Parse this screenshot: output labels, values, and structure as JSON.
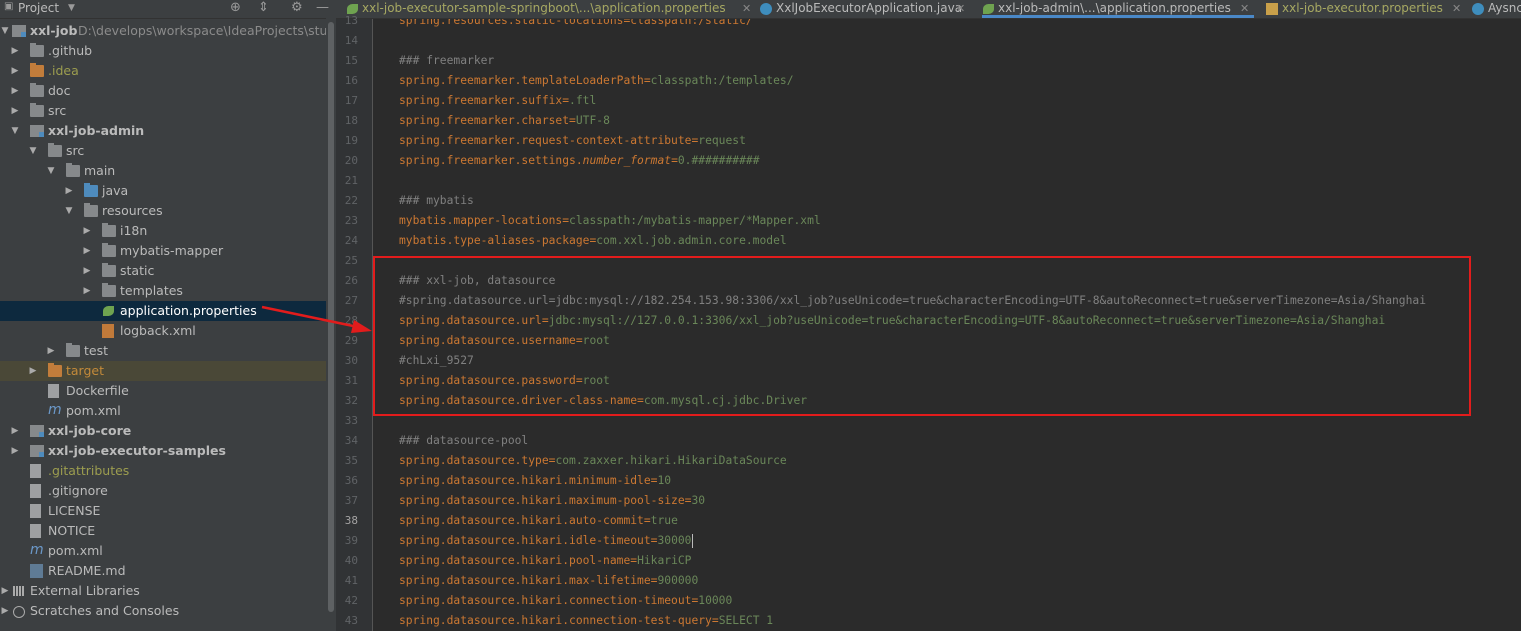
{
  "project_panel": {
    "title": "Project",
    "tree": [
      {
        "label": "xxl-job",
        "path": "D:\\develops\\workspace\\IdeaProjects\\study-"
      },
      {
        "label": ".github"
      },
      {
        "label": ".idea"
      },
      {
        "label": "doc"
      },
      {
        "label": "src"
      },
      {
        "label": "xxl-job-admin"
      },
      {
        "label": "src"
      },
      {
        "label": "main"
      },
      {
        "label": "java"
      },
      {
        "label": "resources"
      },
      {
        "label": "i18n"
      },
      {
        "label": "mybatis-mapper"
      },
      {
        "label": "static"
      },
      {
        "label": "templates"
      },
      {
        "label": "application.properties"
      },
      {
        "label": "logback.xml"
      },
      {
        "label": "test"
      },
      {
        "label": "target"
      },
      {
        "label": "Dockerfile"
      },
      {
        "label": "pom.xml"
      },
      {
        "label": "xxl-job-core"
      },
      {
        "label": "xxl-job-executor-samples"
      },
      {
        "label": ".gitattributes"
      },
      {
        "label": ".gitignore"
      },
      {
        "label": "LICENSE"
      },
      {
        "label": "NOTICE"
      },
      {
        "label": "pom.xml"
      },
      {
        "label": "README.md"
      },
      {
        "label": "External Libraries"
      },
      {
        "label": "Scratches and Consoles"
      }
    ]
  },
  "tabs": [
    {
      "label": "xxl-job-executor-sample-springboot\\...\\application.properties"
    },
    {
      "label": "XxlJobExecutorApplication.java"
    },
    {
      "label": "xxl-job-admin\\...\\application.properties"
    },
    {
      "label": "xxl-job-executor.properties"
    },
    {
      "label": "Aysnc"
    }
  ],
  "editor": {
    "current_line": "38",
    "lines": [
      {
        "n": "13",
        "p": [
          {
            "t": "spring.resources.static-locations=classpath:/static/",
            "c": "k"
          }
        ]
      },
      {
        "n": "14",
        "p": []
      },
      {
        "n": "15",
        "p": [
          {
            "t": "### freemarker",
            "c": "cm"
          }
        ]
      },
      {
        "n": "16",
        "p": [
          {
            "t": "spring.freemarker.templateLoaderPath",
            "c": "k"
          },
          {
            "t": "=",
            "c": "eq"
          },
          {
            "t": "classpath:/templates/",
            "c": "v"
          }
        ]
      },
      {
        "n": "17",
        "p": [
          {
            "t": "spring.freemarker.suffix",
            "c": "k"
          },
          {
            "t": "=",
            "c": "eq"
          },
          {
            "t": ".ftl",
            "c": "v"
          }
        ]
      },
      {
        "n": "18",
        "p": [
          {
            "t": "spring.freemarker.charset",
            "c": "k"
          },
          {
            "t": "=",
            "c": "eq"
          },
          {
            "t": "UTF-8",
            "c": "v"
          }
        ]
      },
      {
        "n": "19",
        "p": [
          {
            "t": "spring.freemarker.request-context-attribute",
            "c": "k"
          },
          {
            "t": "=",
            "c": "eq"
          },
          {
            "t": "request",
            "c": "v"
          }
        ]
      },
      {
        "n": "20",
        "p": [
          {
            "t": "spring.freemarker.settings.",
            "c": "k"
          },
          {
            "t": "number_format",
            "c": "k it"
          },
          {
            "t": "=",
            "c": "eq"
          },
          {
            "t": "0.##########",
            "c": "v"
          }
        ]
      },
      {
        "n": "21",
        "p": []
      },
      {
        "n": "22",
        "p": [
          {
            "t": "### mybatis",
            "c": "cm"
          }
        ]
      },
      {
        "n": "23",
        "p": [
          {
            "t": "mybatis.mapper-locations",
            "c": "k"
          },
          {
            "t": "=",
            "c": "eq"
          },
          {
            "t": "classpath:/mybatis-mapper/*Mapper.xml",
            "c": "v"
          }
        ]
      },
      {
        "n": "24",
        "p": [
          {
            "t": "mybatis.type-aliases-package",
            "c": "k"
          },
          {
            "t": "=",
            "c": "eq"
          },
          {
            "t": "com.xxl.job.admin.core.model",
            "c": "v"
          }
        ]
      },
      {
        "n": "25",
        "p": []
      },
      {
        "n": "26",
        "p": [
          {
            "t": "### xxl-job, datasource",
            "c": "cm"
          }
        ]
      },
      {
        "n": "27",
        "p": [
          {
            "t": "#spring.datasource.url=jdbc:mysql://182.254.153.98:3306/xxl_job?useUnicode=true&characterEncoding=UTF-8&autoReconnect=true&serverTimezone=Asia/Shanghai",
            "c": "cm"
          }
        ]
      },
      {
        "n": "28",
        "p": [
          {
            "t": "spring.datasource.url",
            "c": "k"
          },
          {
            "t": "=",
            "c": "eq"
          },
          {
            "t": "jdbc:mysql://127.0.0.1:3306/xxl_job?useUnicode=true&characterEncoding=UTF-8&autoReconnect=true&serverTimezone=Asia/Shanghai",
            "c": "v"
          }
        ]
      },
      {
        "n": "29",
        "p": [
          {
            "t": "spring.datasource.username",
            "c": "k"
          },
          {
            "t": "=",
            "c": "eq"
          },
          {
            "t": "root",
            "c": "v"
          }
        ]
      },
      {
        "n": "30",
        "p": [
          {
            "t": "#chLxi_9527",
            "c": "cm"
          }
        ]
      },
      {
        "n": "31",
        "p": [
          {
            "t": "spring.datasource.password",
            "c": "k"
          },
          {
            "t": "=",
            "c": "eq"
          },
          {
            "t": "root",
            "c": "v"
          }
        ]
      },
      {
        "n": "32",
        "p": [
          {
            "t": "spring.datasource.driver-class-name",
            "c": "k"
          },
          {
            "t": "=",
            "c": "eq"
          },
          {
            "t": "com.mysql.cj.jdbc.Driver",
            "c": "v"
          }
        ]
      },
      {
        "n": "33",
        "p": []
      },
      {
        "n": "34",
        "p": [
          {
            "t": "### datasource-pool",
            "c": "cm"
          }
        ]
      },
      {
        "n": "35",
        "p": [
          {
            "t": "spring.datasource.type",
            "c": "k"
          },
          {
            "t": "=",
            "c": "eq"
          },
          {
            "t": "com.zaxxer.hikari.HikariDataSource",
            "c": "v"
          }
        ]
      },
      {
        "n": "36",
        "p": [
          {
            "t": "spring.datasource.hikari.minimum-idle",
            "c": "k"
          },
          {
            "t": "=",
            "c": "eq"
          },
          {
            "t": "10",
            "c": "v"
          }
        ]
      },
      {
        "n": "37",
        "p": [
          {
            "t": "spring.datasource.hikari.maximum-pool-size",
            "c": "k"
          },
          {
            "t": "=",
            "c": "eq"
          },
          {
            "t": "30",
            "c": "v"
          }
        ]
      },
      {
        "n": "38",
        "p": [
          {
            "t": "spring.datasource.hikari.auto-commit",
            "c": "k"
          },
          {
            "t": "=",
            "c": "eq"
          },
          {
            "t": "true",
            "c": "v"
          }
        ]
      },
      {
        "n": "39",
        "p": [
          {
            "t": "spring.datasource.hikari.idle-timeout",
            "c": "k"
          },
          {
            "t": "=",
            "c": "eq"
          },
          {
            "t": "30000",
            "c": "v"
          }
        ]
      },
      {
        "n": "40",
        "p": [
          {
            "t": "spring.datasource.hikari.pool-name",
            "c": "k"
          },
          {
            "t": "=",
            "c": "eq"
          },
          {
            "t": "HikariCP",
            "c": "v"
          }
        ]
      },
      {
        "n": "41",
        "p": [
          {
            "t": "spring.datasource.hikari.max-lifetime",
            "c": "k"
          },
          {
            "t": "=",
            "c": "eq"
          },
          {
            "t": "900000",
            "c": "v"
          }
        ]
      },
      {
        "n": "42",
        "p": [
          {
            "t": "spring.datasource.hikari.connection-timeout",
            "c": "k"
          },
          {
            "t": "=",
            "c": "eq"
          },
          {
            "t": "10000",
            "c": "v"
          }
        ]
      },
      {
        "n": "43",
        "p": [
          {
            "t": "spring.datasource.hikari.connection-test-query",
            "c": "k"
          },
          {
            "t": "=",
            "c": "eq"
          },
          {
            "t": "SELECT 1",
            "c": "v"
          }
        ]
      }
    ]
  }
}
